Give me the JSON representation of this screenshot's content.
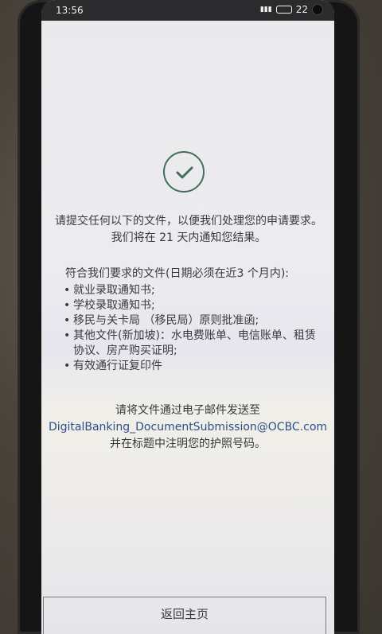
{
  "status_bar": {
    "time": "13:56",
    "battery": "22"
  },
  "content": {
    "intro": "请提交任何以下的文件，以便我们处理您的申请要求。我们将在 21 天内通知您结果。",
    "requirements_heading": "符合我们要求的文件(日期必须在近3 个月内):",
    "requirements": [
      "就业录取通知书;",
      "学校录取通知书;",
      "移民与关卡局 （移民局）原则批准函;",
      "其他文件(新加坡)：水电费账单、电信账单、租赁协议、房产购买证明;",
      "有效通行证复印件"
    ],
    "submit_prefix": "请将文件通过电子邮件发送至",
    "email": "DigitalBanking_DocumentSubmission@OCBC.com",
    "submit_suffix": "并在标题中注明您的护照号码。"
  },
  "buttons": {
    "home": "返回主页"
  },
  "colors": {
    "accent": "#3f6f56",
    "link": "#2c4f88"
  },
  "icons": [
    "check-icon",
    "battery-icon",
    "signal-icon",
    "camera-icon"
  ]
}
